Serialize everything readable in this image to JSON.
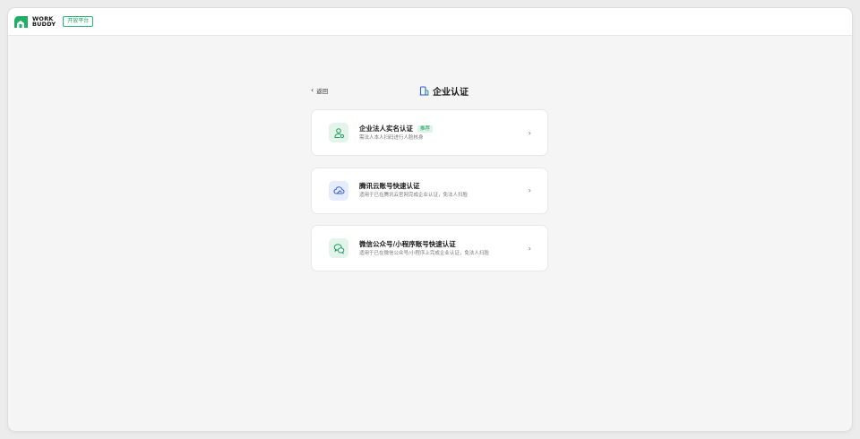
{
  "brand": {
    "logo_line1": "WORK",
    "logo_line2": "BUDDY",
    "platform_label": "开放平台"
  },
  "page": {
    "back_label": "返回",
    "title": "企业认证"
  },
  "options": [
    {
      "title": "企业法人实名认证",
      "tag": "推荐",
      "description": "需法人本人扫码进行人脸核身",
      "icon": "person-check-icon"
    },
    {
      "title": "腾讯云账号快速认证",
      "tag": "",
      "description": "适用于已在腾讯云官网完成企业认证，免法人扫脸",
      "icon": "cloud-icon"
    },
    {
      "title": "微信公众号/小程序账号快速认证",
      "tag": "",
      "description": "适用于已在微信公众号/小程序上完成企业认证，免法人扫脸",
      "icon": "wechat-icon"
    }
  ],
  "colors": {
    "accent_green": "#1f9d60",
    "accent_blue": "#2f5fe0",
    "background": "#f5f5f6"
  }
}
